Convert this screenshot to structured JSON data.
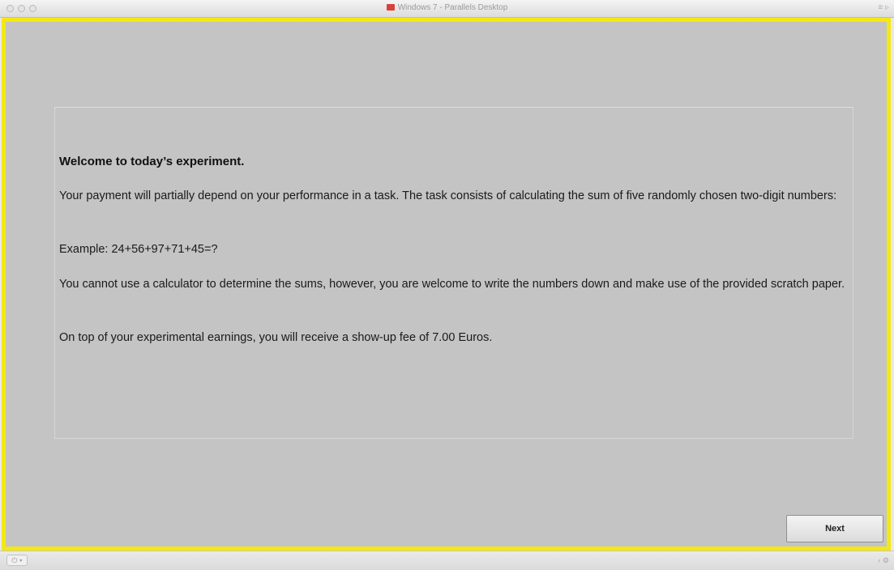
{
  "window": {
    "title": "Windows 7 - Parallels Desktop",
    "titlebar_right": "≡ ▹"
  },
  "content": {
    "heading": "Welcome to today’s experiment.",
    "paragraph1": "Your payment will partially depend on your performance in a task. The task consists of calculating the sum of five randomly chosen two-digit numbers:",
    "paragraph2": "Example: 24+56+97+71+45=?",
    "paragraph3": "You cannot use a calculator to determine the sums, however, you are welcome to write the numbers down and make use of the provided scratch paper.",
    "paragraph4": "On top of your experimental earnings, you will receive a show-up fee of 7.00 Euros."
  },
  "buttons": {
    "next_label": "Next"
  },
  "statusbar": {
    "power_label": "⏻ ▾",
    "right_label": "‹ ⚙"
  },
  "colors": {
    "screen_border": "#f4e814",
    "screen_background": "#c4c4c4"
  }
}
